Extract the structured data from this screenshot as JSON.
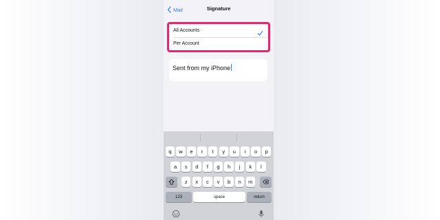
{
  "nav": {
    "back_label": "Mail",
    "title": "Signature"
  },
  "options": {
    "items": [
      {
        "label": "All Accounts",
        "selected": true
      },
      {
        "label": "Per Account",
        "selected": false
      }
    ],
    "highlight_color": "#e4266f"
  },
  "signature": {
    "text": "Sent from my iPhone"
  },
  "keyboard": {
    "row1": [
      "q",
      "w",
      "e",
      "r",
      "t",
      "y",
      "u",
      "i",
      "o",
      "p"
    ],
    "row2": [
      "a",
      "s",
      "d",
      "f",
      "g",
      "h",
      "j",
      "k",
      "l"
    ],
    "row3": [
      "z",
      "x",
      "c",
      "v",
      "b",
      "n",
      "m"
    ],
    "shift_icon": "shift-icon",
    "delete_icon": "delete-icon",
    "numbers_label": "123",
    "space_label": "space",
    "return_label": "return",
    "emoji_icon": "emoji-icon",
    "mic_icon": "microphone-icon"
  },
  "colors": {
    "accent": "#2f7df6",
    "keyboard_bg": "#d1d3d9",
    "screen_bg": "#f2f2f7"
  }
}
